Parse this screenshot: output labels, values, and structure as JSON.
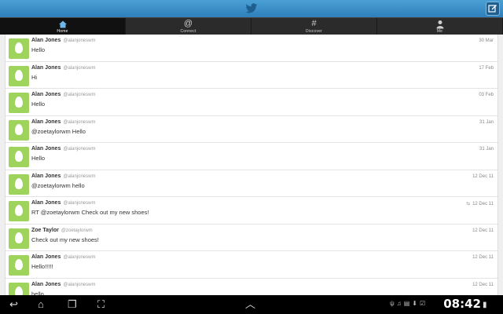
{
  "app": {
    "accent": "#3a8fcc",
    "brand_icon": "twitter-bird-icon"
  },
  "tabs": [
    {
      "label": "Home",
      "icon": "home-icon",
      "active": true
    },
    {
      "label": "Connect",
      "icon": "at-icon",
      "glyph": "@"
    },
    {
      "label": "Discover",
      "icon": "hash-icon",
      "glyph": "#"
    },
    {
      "label": "Me",
      "icon": "person-icon"
    }
  ],
  "tweets": [
    {
      "name": "Alan Jones",
      "handle": "@alanjoneswm",
      "text": "Hello",
      "date": "30 Mar"
    },
    {
      "name": "Alan Jones",
      "handle": "@alanjoneswm",
      "text": "Hi",
      "date": "17 Feb"
    },
    {
      "name": "Alan Jones",
      "handle": "@alanjoneswm",
      "text": "Hello",
      "date": "03 Feb"
    },
    {
      "name": "Alan Jones",
      "handle": "@alanjoneswm",
      "text": "@zoetaylorwm Hello",
      "date": "31 Jan"
    },
    {
      "name": "Alan Jones",
      "handle": "@alanjoneswm",
      "text": "Hello",
      "date": "31 Jan"
    },
    {
      "name": "Alan Jones",
      "handle": "@alanjoneswm",
      "text": "@zoetaylorwm hello",
      "date": "12 Dec 11"
    },
    {
      "name": "Alan Jones",
      "handle": "@alanjoneswm",
      "text": "RT @zoetaylorwm Check out my new shoes!",
      "date": "12 Dec 11",
      "retweet": true
    },
    {
      "name": "Zoe Taylor",
      "handle": "@zoetaylorwm",
      "text": "Check out my new shoes!",
      "date": "12 Dec 11"
    },
    {
      "name": "Alan Jones",
      "handle": "@alanjoneswm",
      "text": "Hello!!!!!",
      "date": "12 Dec 11"
    },
    {
      "name": "Alan Jones",
      "handle": "@alanjoneswm",
      "text": "hello",
      "date": "12 Dec 11"
    }
  ],
  "system_bar": {
    "time": "08:42",
    "icons": [
      "back-icon",
      "home-icon",
      "recent-apps-icon",
      "screenshot-icon",
      "up-arrow-icon",
      "usb-icon",
      "music-icon",
      "sdcard-icon",
      "download-icon",
      "check-icon",
      "wifi-icon",
      "signal-icon",
      "battery-icon"
    ]
  }
}
